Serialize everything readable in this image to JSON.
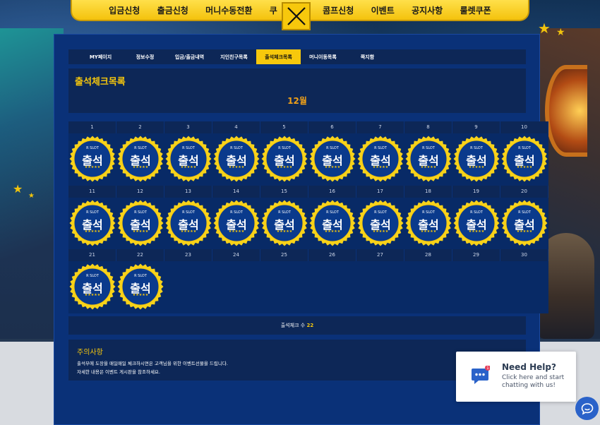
{
  "nav": {
    "items": [
      "입금신청",
      "출금신청",
      "머니수동전환",
      "쿠",
      "콤프신청",
      "이벤트",
      "공지사항",
      "룰렛쿠폰"
    ]
  },
  "tabs": [
    "MY페이지",
    "정보수정",
    "입금/출금내역",
    "지인친구목록",
    "출석체크목록",
    "머니이동목록",
    "쪽지함"
  ],
  "active_tab": "출석체크목록",
  "page_title": "출석체크목록",
  "month_label": "12월",
  "calendar": {
    "days": [
      "1",
      "2",
      "3",
      "4",
      "5",
      "6",
      "7",
      "8",
      "9",
      "10",
      "11",
      "12",
      "13",
      "14",
      "15",
      "16",
      "17",
      "18",
      "19",
      "20",
      "21",
      "22",
      "23",
      "24",
      "25",
      "26",
      "27",
      "28",
      "29",
      "30"
    ],
    "checked_count": 22,
    "badge": {
      "brand": "R SLOT",
      "label": "출석",
      "stars": "★★★★★"
    }
  },
  "summary": {
    "label": "출석체크 수",
    "count": "22"
  },
  "notice": {
    "title": "주의사항",
    "lines": [
      "출석부에 도장을 매일매일 체크하시면은 고객님을 위한 이벤트선물을 드립니다.",
      "자세한 내용은 이벤트 게시판을 참조하세요."
    ]
  },
  "help_widget": {
    "title": "Need Help?",
    "subtitle": "Click here and start chatting with us!",
    "badge_count": "1"
  },
  "colors": {
    "accent": "#f7c80c",
    "panel": "#0a3178",
    "panel_dark": "#0d2757",
    "chat": "#2a62c9"
  }
}
